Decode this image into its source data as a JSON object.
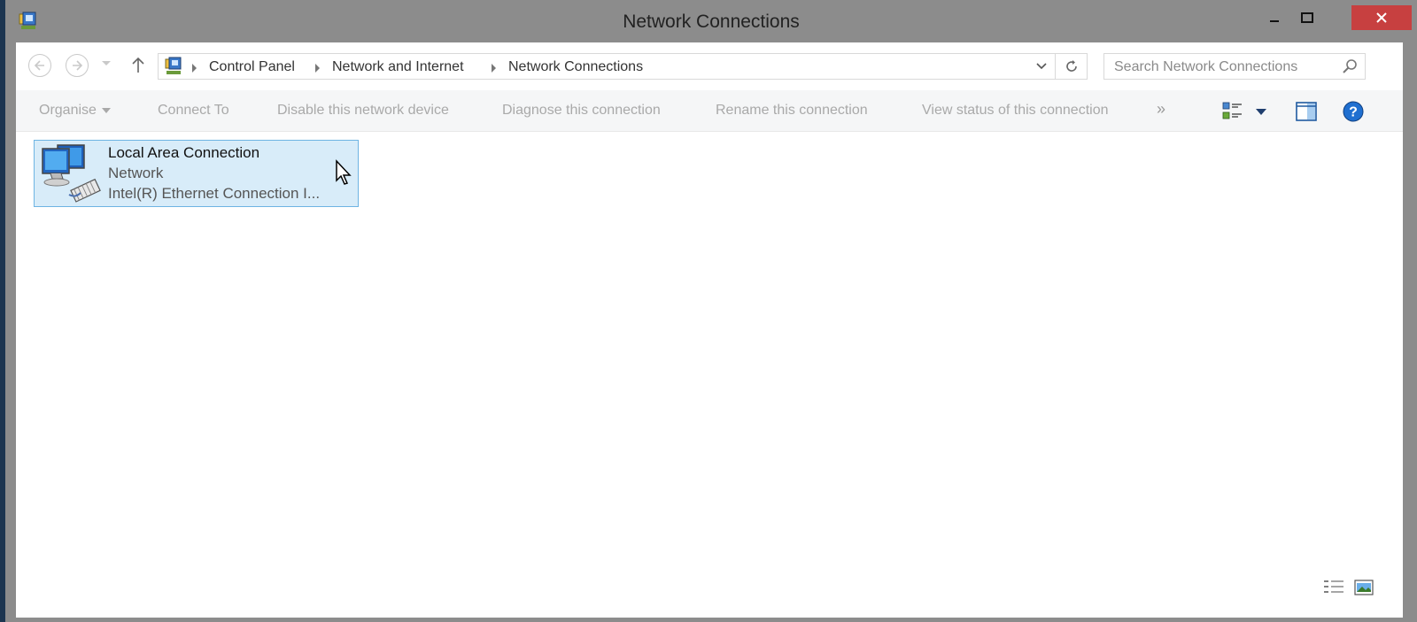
{
  "window": {
    "title": "Network Connections"
  },
  "address": {
    "breadcrumb": [
      "Control Panel",
      "Network and Internet",
      "Network Connections"
    ]
  },
  "search": {
    "placeholder": "Search Network Connections"
  },
  "commands": {
    "organise": "Organise",
    "connect_to": "Connect To",
    "disable": "Disable this network device",
    "diagnose": "Diagnose this connection",
    "rename": "Rename this connection",
    "view_status": "View status of this connection",
    "more": "»"
  },
  "items": [
    {
      "name": "Local Area Connection",
      "status": "Network",
      "device": "Intel(R) Ethernet Connection I..."
    }
  ],
  "colors": {
    "close_button": "#c74040",
    "selection_fill": "#d8ecf9",
    "selection_border": "#6eb4e3"
  }
}
